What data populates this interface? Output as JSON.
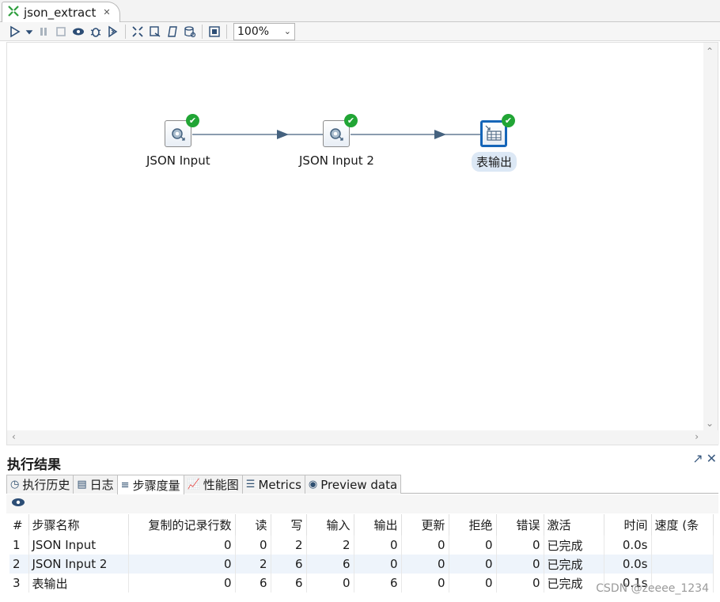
{
  "tab": {
    "title": "json_extract",
    "close": "✕"
  },
  "toolbar": {
    "zoom": "100%"
  },
  "canvas": {
    "steps": [
      {
        "label": "JSON Input"
      },
      {
        "label": "JSON Input 2"
      },
      {
        "label": "表输出"
      }
    ]
  },
  "results": {
    "title": "执行结果",
    "tabs": [
      {
        "label": "执行历史"
      },
      {
        "label": "日志"
      },
      {
        "label": "步骤度量"
      },
      {
        "label": "性能图"
      },
      {
        "label": "Metrics"
      },
      {
        "label": "Preview data"
      }
    ],
    "columns": [
      "#",
      "步骤名称",
      "复制的记录行数",
      "读",
      "写",
      "输入",
      "输出",
      "更新",
      "拒绝",
      "错误",
      "激活",
      "时间",
      "速度 (条"
    ],
    "rows": [
      [
        "1",
        "JSON Input",
        "0",
        "0",
        "2",
        "2",
        "0",
        "0",
        "0",
        "0",
        "已完成",
        "0.0s",
        ""
      ],
      [
        "2",
        "JSON Input 2",
        "0",
        "2",
        "6",
        "6",
        "0",
        "0",
        "0",
        "0",
        "已完成",
        "0.0s",
        ""
      ],
      [
        "3",
        "表输出",
        "0",
        "6",
        "6",
        "0",
        "6",
        "0",
        "0",
        "0",
        "已完成",
        "0.1s",
        ""
      ]
    ]
  },
  "watermark": "CSDN @zeeee_1234"
}
